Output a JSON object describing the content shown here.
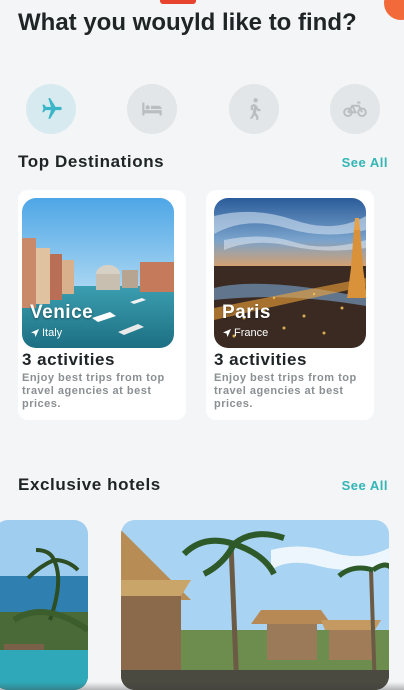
{
  "page": {
    "title": "What you wouyld like to find?"
  },
  "categories": [
    {
      "name": "flights",
      "icon": "airplane-icon",
      "active": true
    },
    {
      "name": "hotels",
      "icon": "bed-icon",
      "active": false
    },
    {
      "name": "activities",
      "icon": "walking-person-icon",
      "active": false
    },
    {
      "name": "bike-rentals",
      "icon": "bicycle-icon",
      "active": false
    }
  ],
  "top_destinations": {
    "title": "Top Destinations",
    "see_all": "See All",
    "cards": [
      {
        "city": "Venice",
        "country": "Italy",
        "activities": "3 activities",
        "description": "Enjoy best trips from top travel agencies at best prices."
      },
      {
        "city": "Paris",
        "country": "France",
        "activities": "3 activities",
        "description": "Enjoy best trips from top travel agencies at best prices."
      }
    ]
  },
  "exclusive_hotels": {
    "title": "Exclusive hotels",
    "see_all": "See All"
  },
  "colors": {
    "accent": "#33b5b5",
    "icon_active": "#3bb6c9",
    "icon_inactive": "#b9bec1",
    "background": "#f3f5f6"
  }
}
